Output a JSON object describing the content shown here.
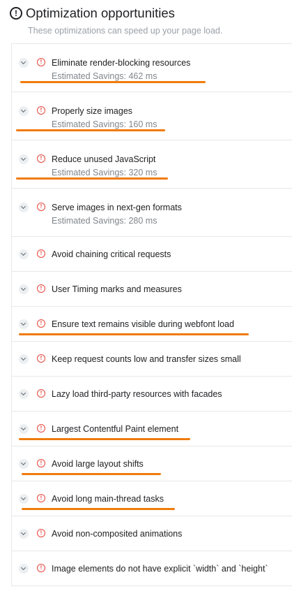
{
  "header": {
    "icon": "exclamation-circle-icon",
    "title": "Optimization opportunities",
    "subtitle": "These optimizations can speed up your page load."
  },
  "accent_color": "#e8453c",
  "highlight_color": "#f07b0c",
  "audits": [
    {
      "title": "Eliminate render-blocking resources",
      "savings": "Estimated Savings: 462 ms",
      "highlighted": true
    },
    {
      "title": "Properly size images",
      "savings": "Estimated Savings: 160 ms",
      "highlighted": true
    },
    {
      "title": "Reduce unused JavaScript",
      "savings": "Estimated Savings: 320 ms",
      "highlighted": true
    },
    {
      "title": "Serve images in next-gen formats",
      "savings": "Estimated Savings: 280 ms",
      "highlighted": false
    },
    {
      "title": "Avoid chaining critical requests",
      "savings": null,
      "highlighted": false
    },
    {
      "title": "User Timing marks and measures",
      "savings": null,
      "highlighted": false
    },
    {
      "title": "Ensure text remains visible during webfont load",
      "savings": null,
      "highlighted": true
    },
    {
      "title": "Keep request counts low and transfer sizes small",
      "savings": null,
      "highlighted": false
    },
    {
      "title": "Lazy load third-party resources with facades",
      "savings": null,
      "highlighted": false
    },
    {
      "title": "Largest Contentful Paint element",
      "savings": null,
      "highlighted": true
    },
    {
      "title": "Avoid large layout shifts",
      "savings": null,
      "highlighted": true
    },
    {
      "title": "Avoid long main-thread tasks",
      "savings": null,
      "highlighted": true
    },
    {
      "title": "Avoid non-composited animations",
      "savings": null,
      "highlighted": false
    },
    {
      "title": "Image elements do not have explicit `width` and `height`",
      "savings": null,
      "highlighted": false
    }
  ]
}
